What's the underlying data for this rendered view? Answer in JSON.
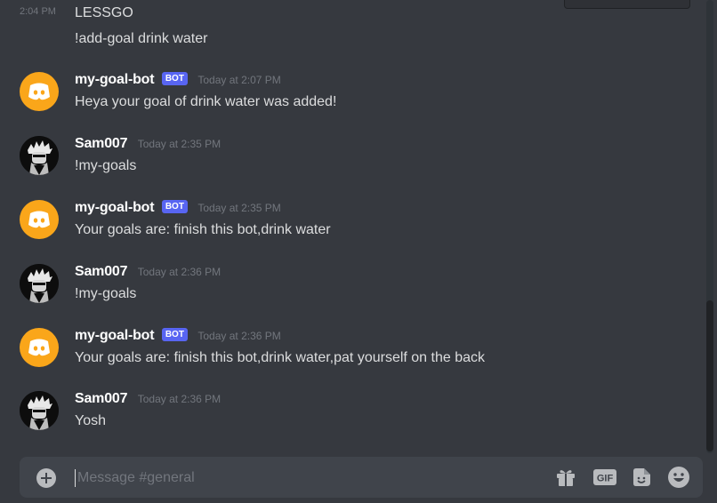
{
  "messages_top": [
    {
      "timestamp": "2:04 PM",
      "text": "LESSGO"
    },
    {
      "timestamp": "",
      "text": "!add-goal drink water"
    }
  ],
  "messages": [
    {
      "author": "my-goal-bot",
      "is_bot": true,
      "bot_tag": "BOT",
      "timestamp": "Today at 2:07 PM",
      "text": "Heya your goal of drink water was added!"
    },
    {
      "author": "Sam007",
      "is_bot": false,
      "timestamp": "Today at 2:35 PM",
      "text": "!my-goals"
    },
    {
      "author": "my-goal-bot",
      "is_bot": true,
      "bot_tag": "BOT",
      "timestamp": "Today at 2:35 PM",
      "text": "Your goals are: finish this bot,drink water"
    },
    {
      "author": "Sam007",
      "is_bot": false,
      "timestamp": "Today at 2:36 PM",
      "text": "!my-goals"
    },
    {
      "author": "my-goal-bot",
      "is_bot": true,
      "bot_tag": "BOT",
      "timestamp": "Today at 2:36 PM",
      "text": "Your goals are: finish this bot,drink water,pat yourself on the back"
    },
    {
      "author": "Sam007",
      "is_bot": false,
      "timestamp": "Today at 2:36 PM",
      "text": "Yosh"
    }
  ],
  "composer": {
    "placeholder": "Message #general",
    "gif_label": "GIF"
  },
  "icons": {
    "add": "plus-circle-icon",
    "gift": "gift-icon",
    "gif": "gif-icon",
    "sticker": "sticker-icon",
    "emoji": "emoji-icon",
    "bot_avatar": "discord-logo-icon"
  },
  "colors": {
    "background": "#36393f",
    "composer": "#40444b",
    "bot_tag": "#5865f2",
    "bot_avatar": "#faa61a",
    "timestamp": "#72767d",
    "text": "#dcddde"
  }
}
